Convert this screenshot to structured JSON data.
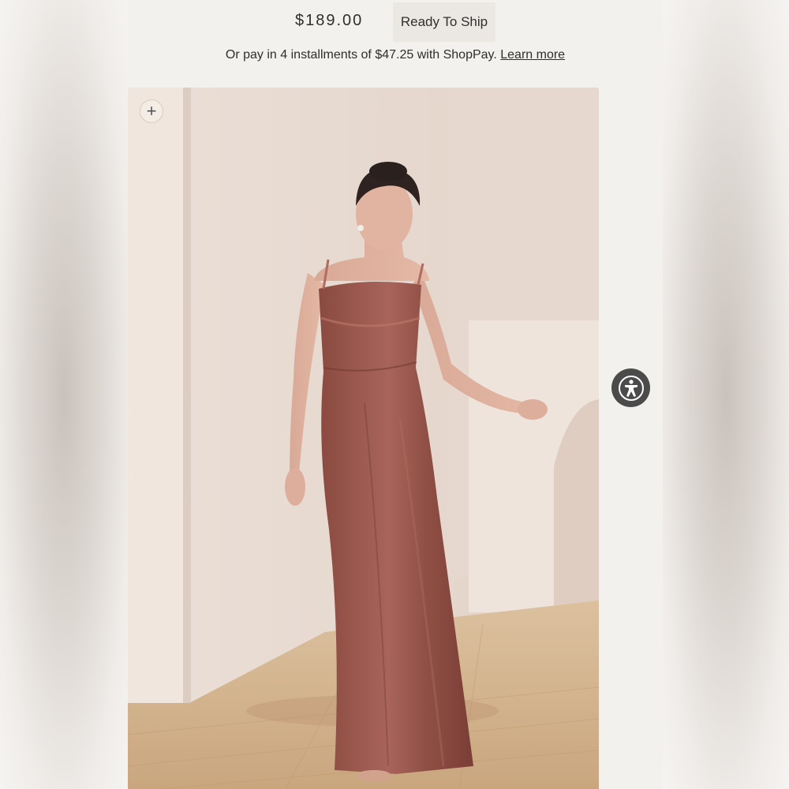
{
  "product": {
    "price": "$189.00",
    "status_badge": "Ready To Ship"
  },
  "payment": {
    "installments_text": "Or pay in 4 installments of $47.25 with ShopPay.",
    "learn_more_label": "Learn more"
  },
  "gallery": {
    "zoom_icon": "plus-icon"
  },
  "accessibility": {
    "icon": "accessibility-icon"
  }
}
